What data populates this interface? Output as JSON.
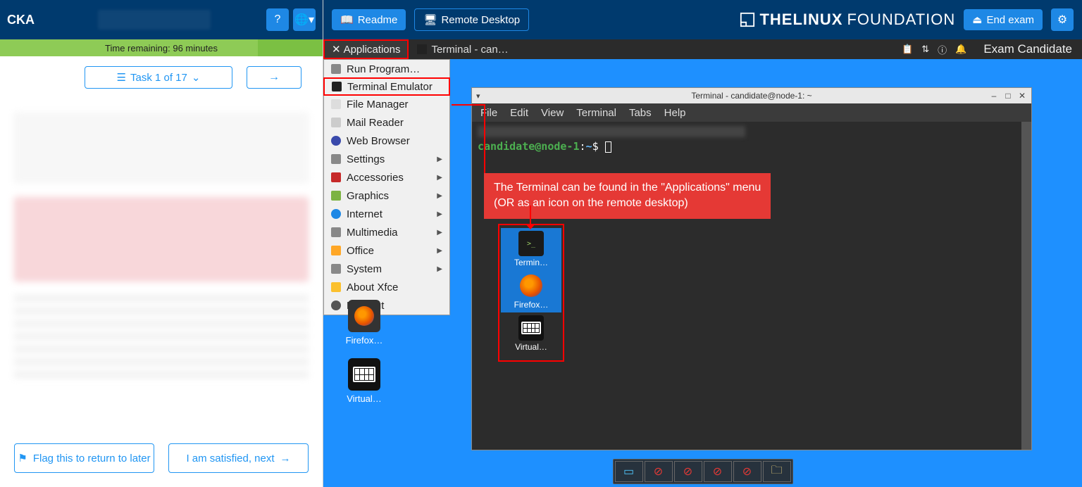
{
  "left": {
    "exam_title": "CKA",
    "time_remaining": "Time remaining: 96 minutes",
    "task_nav": "Task 1 of 17",
    "flag_label": "Flag this to return to later",
    "satisfied_label": "I am satisfied, next"
  },
  "right": {
    "readme_label": "Readme",
    "remote_desktop_label": "Remote Desktop",
    "logo_bold": "THELINUX",
    "logo_thin": "FOUNDATION",
    "end_exam_label": "End exam"
  },
  "taskbar": {
    "applications": "Applications",
    "current_window": "Terminal - can…",
    "candidate": "Exam Candidate"
  },
  "app_menu": {
    "run_program": "Run Program…",
    "terminal_emulator": "Terminal Emulator",
    "file_manager": "File Manager",
    "mail_reader": "Mail Reader",
    "web_browser": "Web Browser",
    "settings": "Settings",
    "accessories": "Accessories",
    "graphics": "Graphics",
    "internet": "Internet",
    "multimedia": "Multimedia",
    "office": "Office",
    "system": "System",
    "about": "About Xfce",
    "logout": "Log Out"
  },
  "desktop_icons": {
    "terminal": "Termin…",
    "firefox": "Firefox…",
    "virtual": "Virtual…"
  },
  "terminal": {
    "title": "Terminal - candidate@node-1: ~",
    "menu": {
      "file": "File",
      "edit": "Edit",
      "view": "View",
      "terminal": "Terminal",
      "tabs": "Tabs",
      "help": "Help"
    },
    "prompt_user": "candidate@node-1",
    "prompt_path": "~",
    "prompt_symbol": "$"
  },
  "annotation": {
    "line1": "The Terminal can be found in the \"Applications\" menu",
    "line2": "(OR as an icon on the remote desktop)"
  },
  "overlay_icons": {
    "terminal": "Termin…",
    "firefox": "Firefox…",
    "virtual": "Virtual…"
  }
}
